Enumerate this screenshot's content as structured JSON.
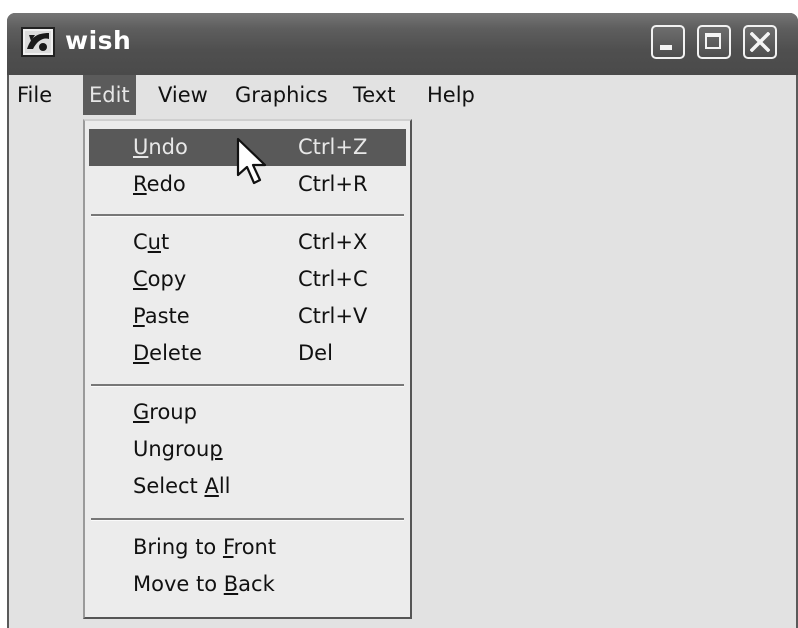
{
  "window": {
    "title": "wish",
    "icon": "app-icon",
    "controls": {
      "minimize": "minimize-icon",
      "maximize": "maximize-icon",
      "close": "close-icon"
    }
  },
  "menubar": {
    "items": [
      {
        "label": "File",
        "active": false
      },
      {
        "label": "Edit",
        "active": true
      },
      {
        "label": "View",
        "active": false
      },
      {
        "label": "Graphics",
        "active": false
      },
      {
        "label": "Text",
        "active": false
      },
      {
        "label": "Help",
        "active": false
      }
    ]
  },
  "edit_menu": {
    "groups": [
      [
        {
          "pre": "",
          "key": "U",
          "post": "ndo",
          "shortcut": "Ctrl+Z",
          "highlighted": true
        },
        {
          "pre": "",
          "key": "R",
          "post": "edo",
          "shortcut": "Ctrl+R",
          "highlighted": false
        }
      ],
      [
        {
          "pre": "C",
          "key": "u",
          "post": "t",
          "shortcut": "Ctrl+X",
          "highlighted": false
        },
        {
          "pre": "",
          "key": "C",
          "post": "opy",
          "shortcut": "Ctrl+C",
          "highlighted": false
        },
        {
          "pre": "",
          "key": "P",
          "post": "aste",
          "shortcut": "Ctrl+V",
          "highlighted": false
        },
        {
          "pre": "",
          "key": "D",
          "post": "elete",
          "shortcut": "Del",
          "highlighted": false
        }
      ],
      [
        {
          "pre": "",
          "key": "G",
          "post": "roup",
          "shortcut": "",
          "highlighted": false
        },
        {
          "pre": "Ungrou",
          "key": "p",
          "post": "",
          "shortcut": "",
          "highlighted": false
        },
        {
          "pre": "Select ",
          "key": "A",
          "post": "ll",
          "shortcut": "",
          "highlighted": false
        }
      ],
      [
        {
          "pre": "Bring to ",
          "key": "F",
          "post": "ront",
          "shortcut": "",
          "highlighted": false
        },
        {
          "pre": "Move to ",
          "key": "B",
          "post": "ack",
          "shortcut": "",
          "highlighted": false
        }
      ]
    ]
  },
  "cursor": {
    "icon": "pointer-cursor-icon"
  }
}
